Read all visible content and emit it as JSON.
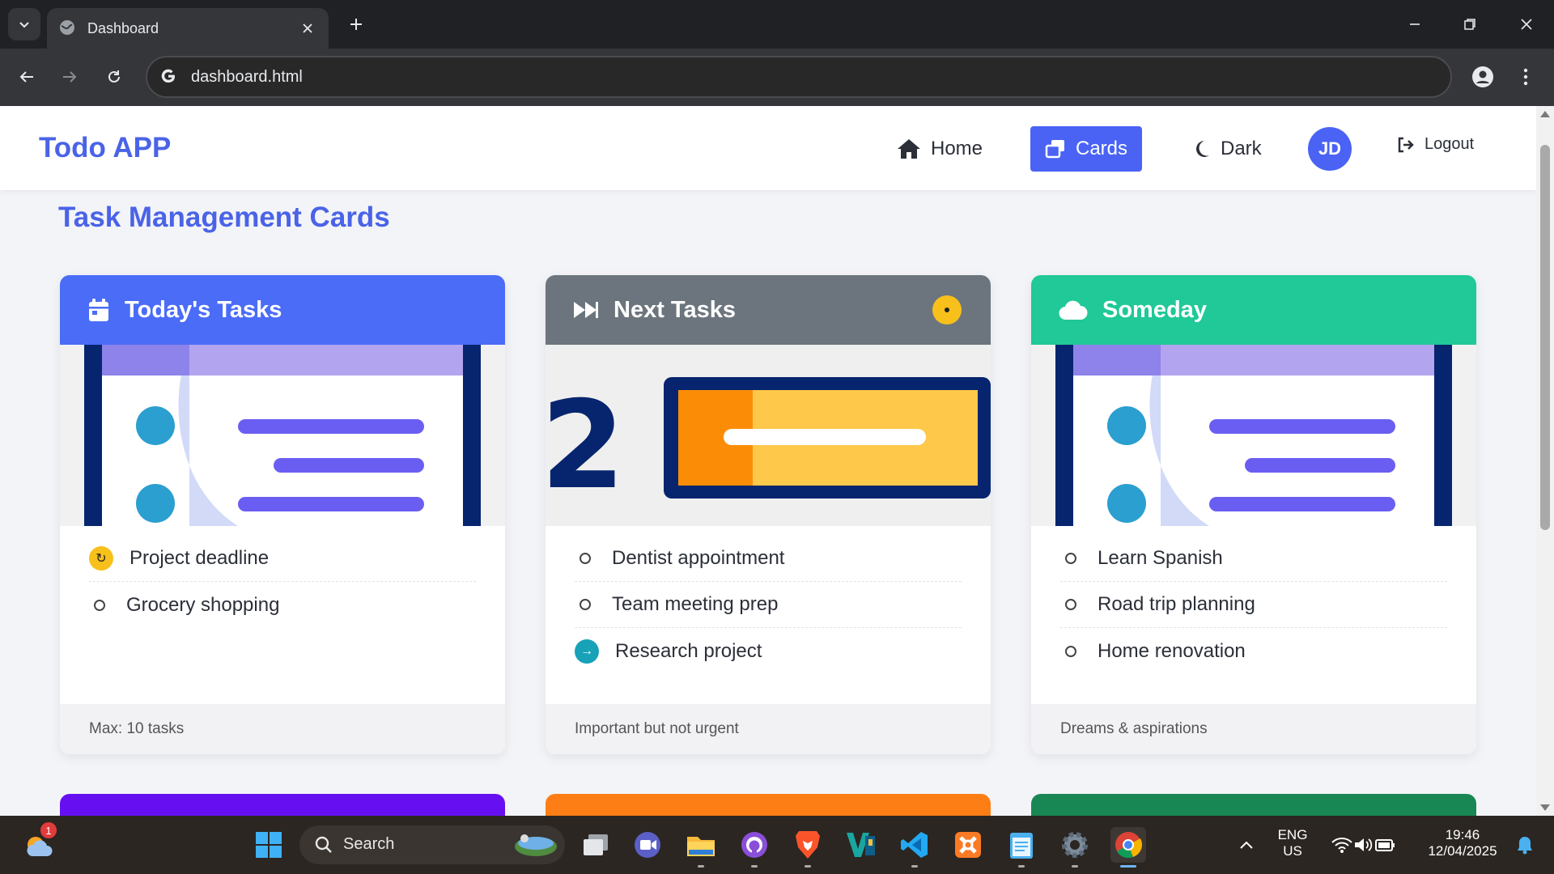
{
  "browser": {
    "tab_title": "Dashboard",
    "url": "dashboard.html"
  },
  "app": {
    "brand": "Todo APP",
    "nav": {
      "home": "Home",
      "cards": "Cards",
      "dark": "Dark",
      "avatar_initials": "JD",
      "logout": "Logout"
    },
    "page_title": "Task Management Cards"
  },
  "cards": [
    {
      "title": "Today's Tasks",
      "header_color": "#4a6cf7",
      "icon": "calendar-icon",
      "tasks": [
        {
          "label": "Project deadline",
          "status": "in-progress"
        },
        {
          "label": "Grocery shopping",
          "status": "todo"
        }
      ],
      "footer": "Max: 10 tasks"
    },
    {
      "title": "Next Tasks",
      "header_color": "#6c757d",
      "icon": "fast-forward-icon",
      "tasks": [
        {
          "label": "Dentist appointment",
          "status": "todo"
        },
        {
          "label": "Team meeting prep",
          "status": "todo"
        },
        {
          "label": "Research project",
          "status": "moved"
        }
      ],
      "footer": "Important but not urgent"
    },
    {
      "title": "Someday",
      "header_color": "#20c997",
      "icon": "cloud-icon",
      "tasks": [
        {
          "label": "Learn Spanish",
          "status": "todo"
        },
        {
          "label": "Road trip planning",
          "status": "todo"
        },
        {
          "label": "Home renovation",
          "status": "todo"
        }
      ],
      "footer": "Dreams & aspirations"
    }
  ],
  "next_row_colors": [
    "#6610f2",
    "#fd7e14",
    "#198754"
  ],
  "taskbar": {
    "search_label": "Search",
    "language_line1": "ENG",
    "language_line2": "US",
    "time": "19:46",
    "date": "12/04/2025",
    "weather_badge": "1"
  }
}
